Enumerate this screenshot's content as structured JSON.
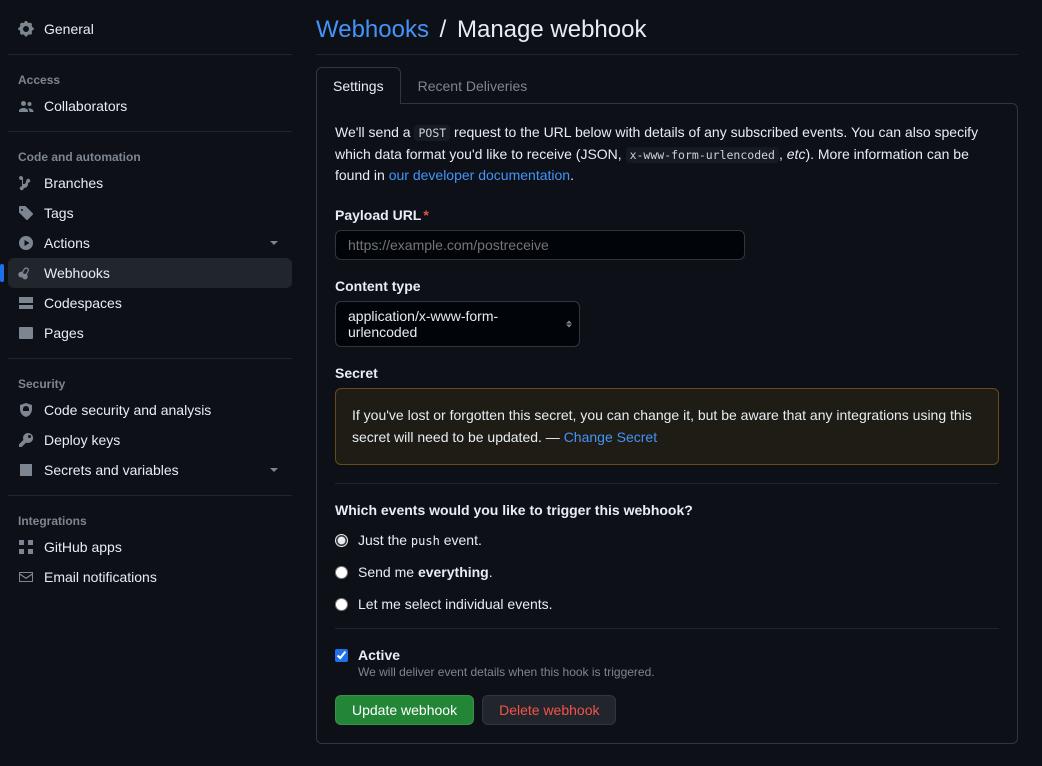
{
  "sidebar": {
    "general": "General",
    "sections": {
      "access": {
        "heading": "Access",
        "items": [
          {
            "label": "Collaborators"
          }
        ]
      },
      "code": {
        "heading": "Code and automation",
        "items": [
          {
            "label": "Branches"
          },
          {
            "label": "Tags"
          },
          {
            "label": "Actions"
          },
          {
            "label": "Webhooks"
          },
          {
            "label": "Codespaces"
          },
          {
            "label": "Pages"
          }
        ]
      },
      "security": {
        "heading": "Security",
        "items": [
          {
            "label": "Code security and analysis"
          },
          {
            "label": "Deploy keys"
          },
          {
            "label": "Secrets and variables"
          }
        ]
      },
      "integrations": {
        "heading": "Integrations",
        "items": [
          {
            "label": "GitHub apps"
          },
          {
            "label": "Email notifications"
          }
        ]
      }
    }
  },
  "header": {
    "crumb": "Webhooks",
    "sep": "/",
    "title": "Manage webhook"
  },
  "tabs": {
    "settings": "Settings",
    "deliveries": "Recent Deliveries"
  },
  "intro": {
    "t1": "We'll send a ",
    "code1": "POST",
    "t2": " request to the URL below with details of any subscribed events. You can also specify which data format you'd like to receive (JSON, ",
    "code2": "x-www-form-urlencoded",
    "t3": ", ",
    "em": "etc",
    "t4": "). More information can be found in ",
    "link": "our developer documentation",
    "t5": "."
  },
  "form": {
    "payload_label": "Payload URL",
    "required": "*",
    "payload_placeholder": "https://example.com/postreceive",
    "payload_value": "",
    "content_type_label": "Content type",
    "content_type_value": "application/x-www-form-urlencoded",
    "secret_label": "Secret",
    "secret_msg1": "If you've lost or forgotten this secret, you can change it, but be aware that any integrations using this secret will need to be updated. — ",
    "secret_link": "Change Secret",
    "events_title": "Which events would you like to trigger this webhook?",
    "opt_push_pre": "Just the ",
    "opt_push_code": "push",
    "opt_push_post": " event.",
    "opt_all_pre": "Send me ",
    "opt_all_strong": "everything",
    "opt_all_post": ".",
    "opt_individual": "Let me select individual events.",
    "active_label": "Active",
    "active_desc": "We will deliver event details when this hook is triggered.",
    "btn_update": "Update webhook",
    "btn_delete": "Delete webhook"
  }
}
